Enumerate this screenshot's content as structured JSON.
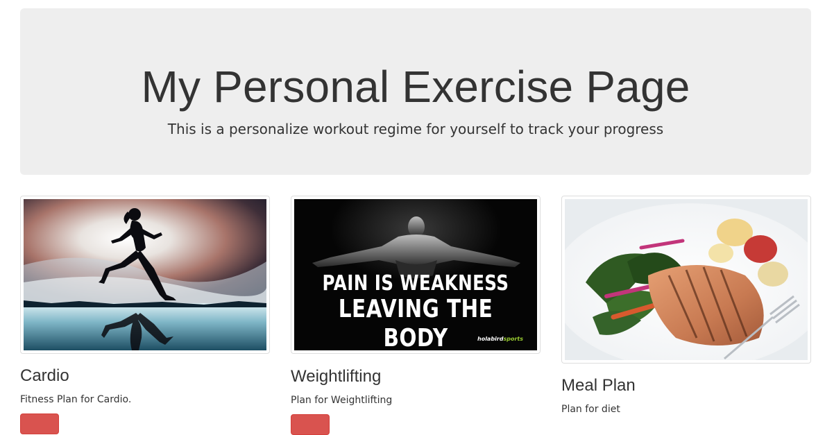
{
  "jumbotron": {
    "title": "My Personal Exercise Page",
    "subtitle": "This is a personalize workout regime for yourself to track your progress"
  },
  "cards": [
    {
      "title": "Cardio",
      "description": "Fitness Plan for Cardio.",
      "image_icon": "running-woman-silhouette-image"
    },
    {
      "title": "Weightlifting",
      "description": "Plan for Weightlifting",
      "image_icon": "motivational-poster-image",
      "poster_line1": "PAIN IS WEAKNESS",
      "poster_line2": "LEAVING THE BODY",
      "poster_brand_a": "holabird",
      "poster_brand_b": "sports"
    },
    {
      "title": "Meal Plan",
      "description": "Plan for diet",
      "image_icon": "salmon-meal-plate-image"
    }
  ],
  "colors": {
    "jumbotron_bg": "#eeeeee",
    "text": "#333333",
    "button_danger": "#d9534f",
    "thumbnail_border": "#dddddd"
  }
}
